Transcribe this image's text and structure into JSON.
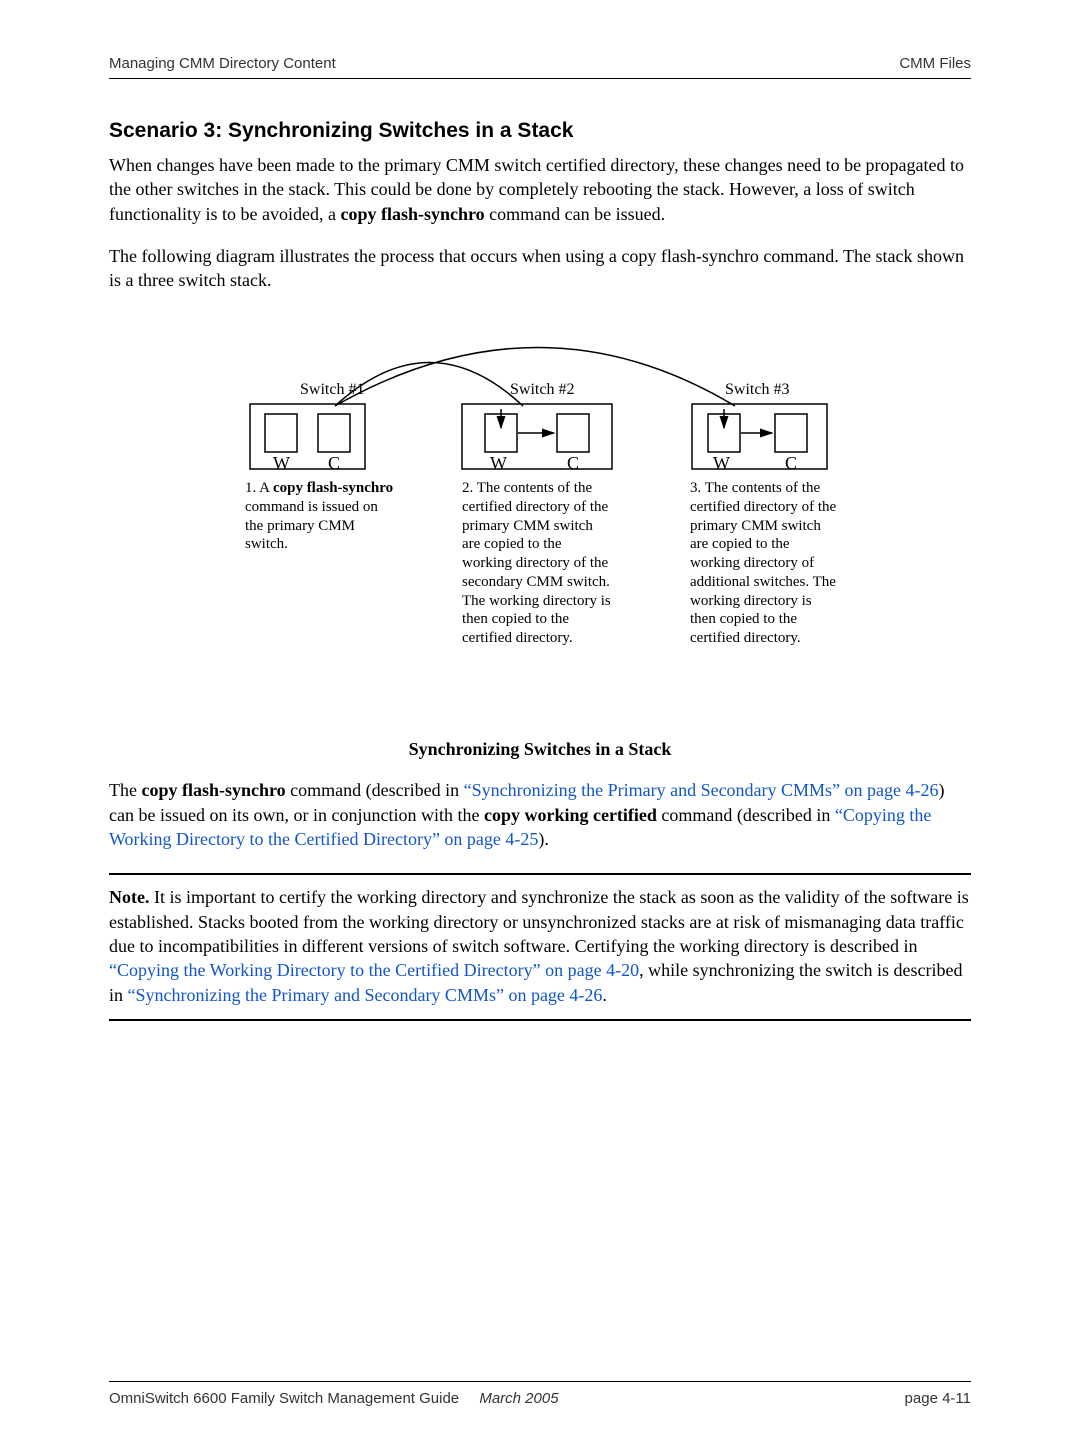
{
  "header": {
    "left": "Managing CMM Directory Content",
    "right": "CMM Files"
  },
  "section_title": "Scenario 3: Synchronizing Switches in a Stack",
  "para1_a": "When changes have been made to the primary CMM switch certified directory, these changes need to be propagated to the other switches in the stack. This could be done by completely rebooting the stack. However, a loss of switch functionality is to be avoided, a ",
  "para1_bold": "copy flash-synchro",
  "para1_b": " command can be issued.",
  "para2": "The following diagram illustrates the process that occurs when using a copy flash-synchro command. The stack shown is a three switch stack.",
  "diagram": {
    "switches": [
      {
        "label": "Switch #1"
      },
      {
        "label": "Switch #2"
      },
      {
        "label": "Switch #3"
      }
    ],
    "box_letters": {
      "w": "W",
      "c": "C"
    },
    "cap1_a": "1. A ",
    "cap1_bold": "copy flash-synchro",
    "cap1_b": " command is issued on the primary CMM switch.",
    "cap2": "2. The contents of the certified directory of the primary CMM switch are copied to the working directory of the secondary CMM switch. The working directory is then copied to the certified directory.",
    "cap3": "3. The contents of the certified directory of the primary CMM switch are copied to the working directory of additional switches. The working directory is then copied to the certified directory."
  },
  "fig_caption": "Synchronizing Switches in a Stack",
  "para3_a": "The ",
  "para3_bold1": "copy flash-synchro",
  "para3_b": " command (described in ",
  "para3_link1": "“Synchronizing the Primary and Secondary CMMs” on page 4-26",
  "para3_c": ") can be issued on its own, or in conjunction with the ",
  "para3_bold2": "copy working certified",
  "para3_d": " command (described in ",
  "para3_link2": "“Copying the Working Directory to the Certified Directory” on page 4-25",
  "para3_e": ").",
  "note": {
    "label": "Note.",
    "a": " It is important to certify the working directory and synchronize the stack as soon as the validity of the software is established. Stacks booted from the working directory or unsynchronized stacks are at risk of mismanaging data traffic due to incompatibilities in different versions of switch software. Certifying the working directory is described in ",
    "link1": "“Copying the Working Directory to the Certified Directory” on page 4-20",
    "b": ", while synchronizing the switch is described in ",
    "link2": "“Synchronizing the Primary and Secondary CMMs” on page 4-26",
    "c": "."
  },
  "footer": {
    "guide": "OmniSwitch 6600 Family Switch Management Guide",
    "date": "March 2005",
    "page": "page 4-11"
  }
}
